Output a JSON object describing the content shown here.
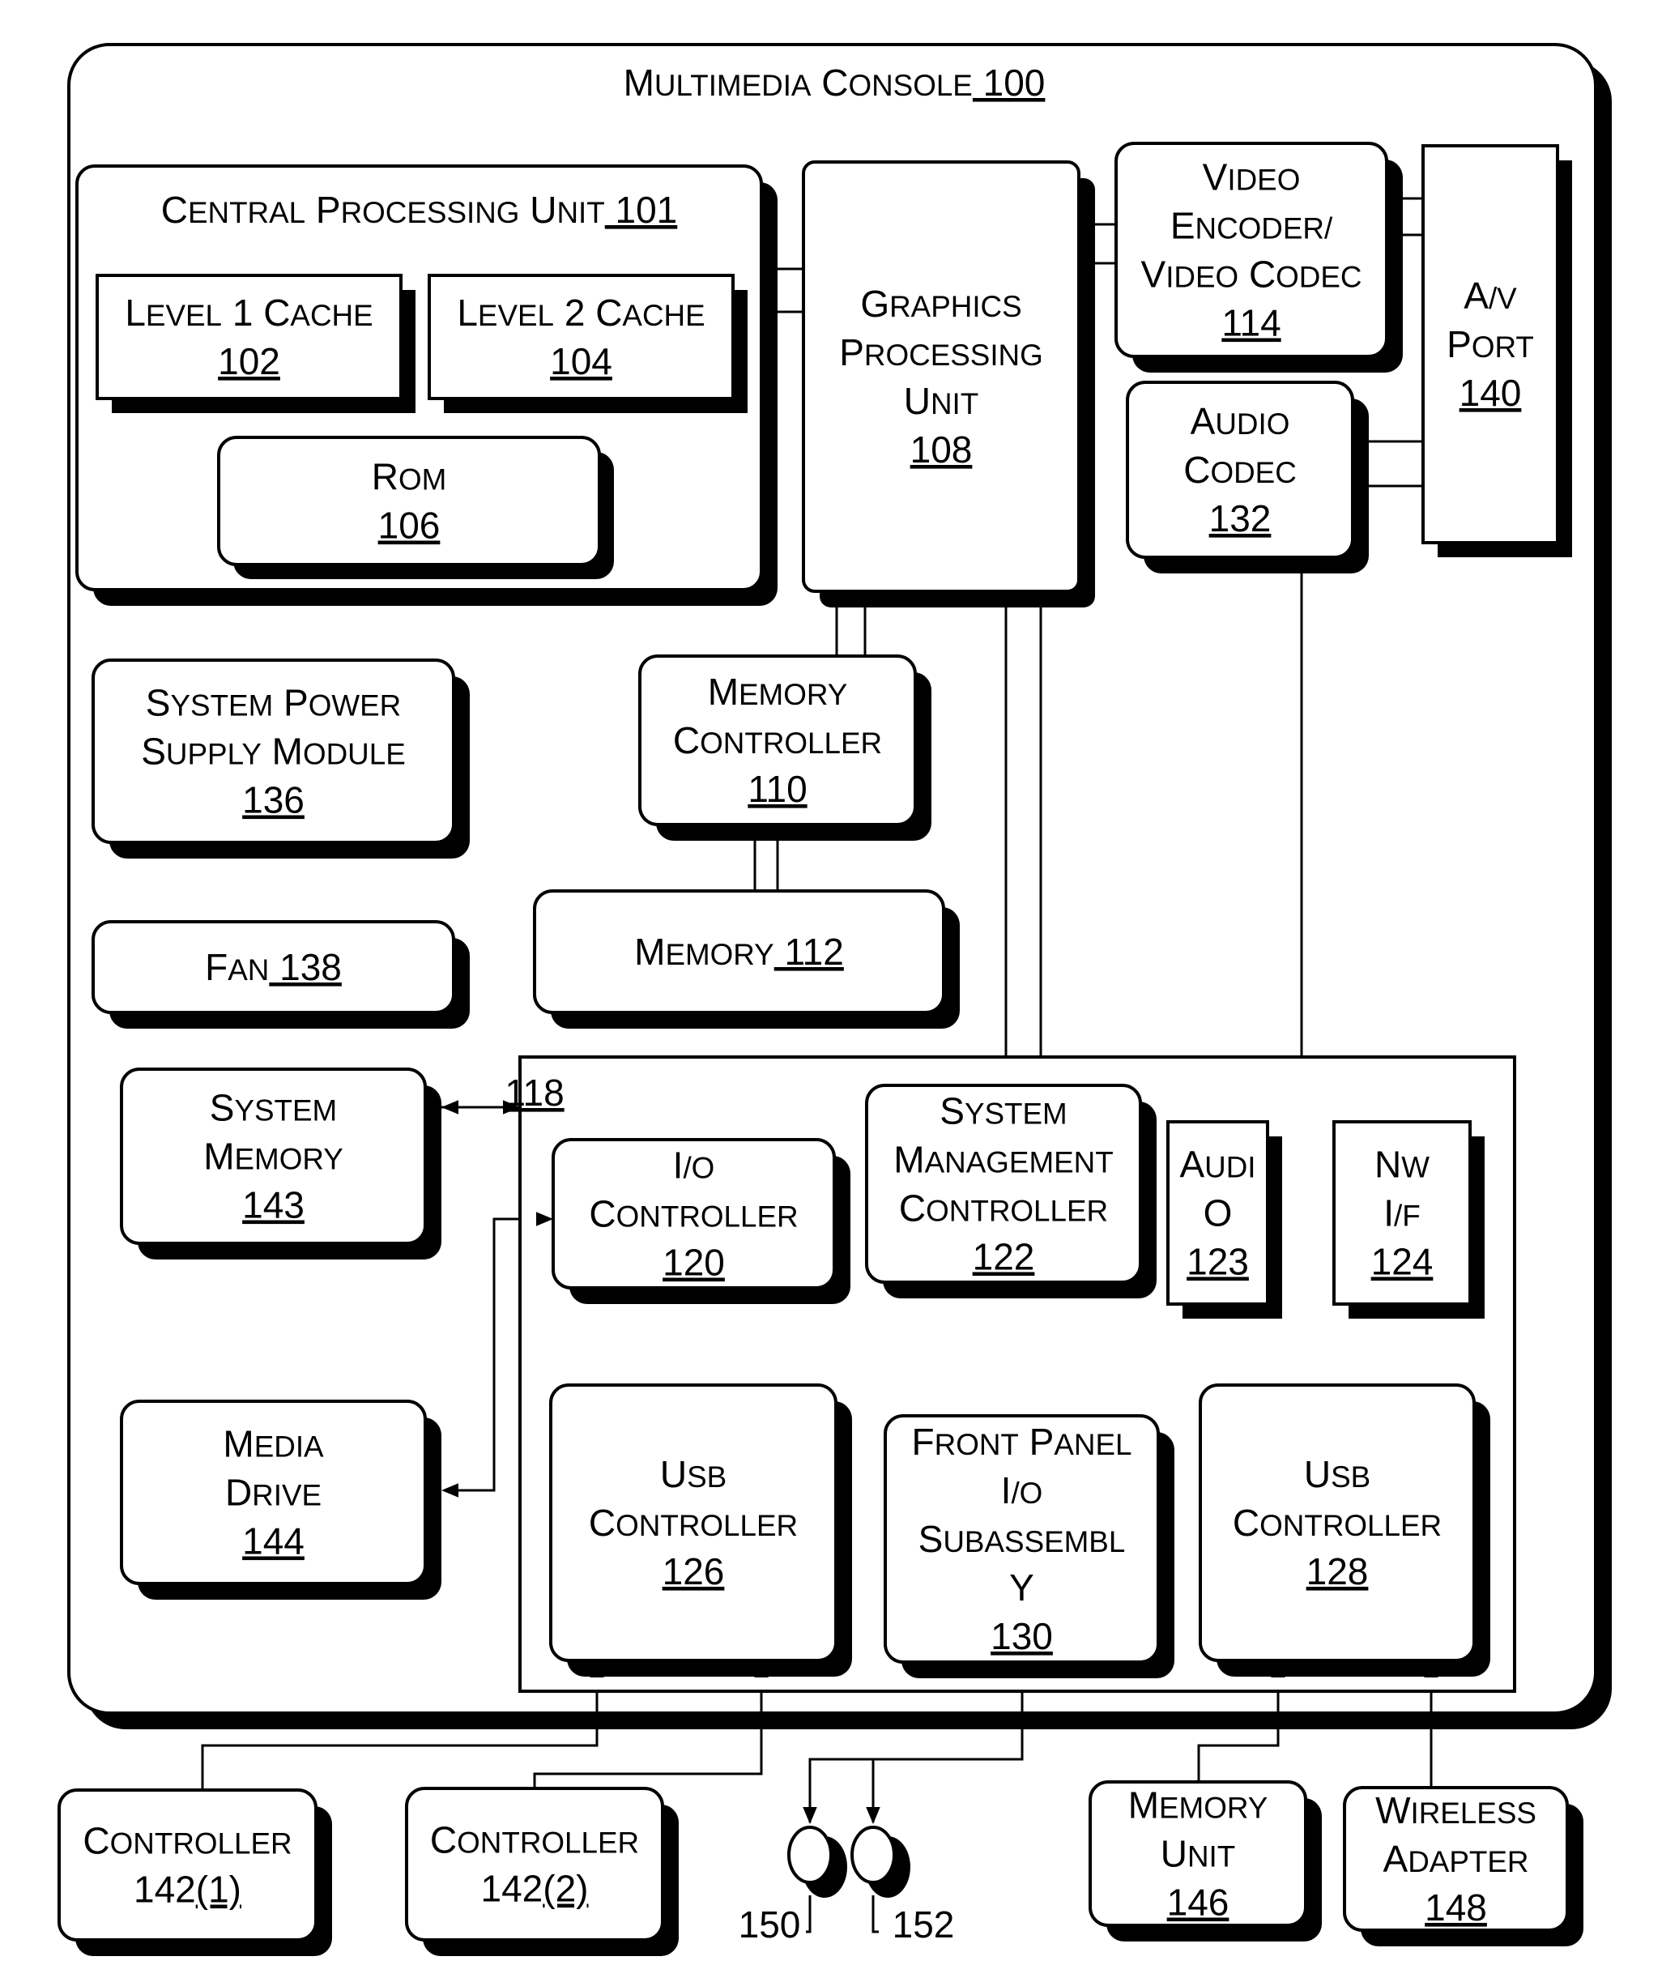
{
  "console": {
    "title": "Multimedia Console",
    "ref": "100"
  },
  "blocks": {
    "cpu": {
      "lines": [
        "Central Processing Unit"
      ],
      "ref": "101"
    },
    "l1": {
      "lines": [
        "Level 1 Cache"
      ],
      "ref": "102"
    },
    "l2": {
      "lines": [
        "Level 2 Cache"
      ],
      "ref": "104"
    },
    "rom": {
      "lines": [
        "ROM"
      ],
      "ref": "106"
    },
    "gpu": {
      "lines": [
        "Graphics",
        "Processing",
        "Unit"
      ],
      "ref": "108"
    },
    "video": {
      "lines": [
        "Video",
        "Encoder/",
        "Video Codec"
      ],
      "ref": "114"
    },
    "av": {
      "lines": [
        "A/V",
        "Port"
      ],
      "ref": "140"
    },
    "audio_codec": {
      "lines": [
        "Audio",
        "Codec"
      ],
      "ref": "132"
    },
    "power": {
      "lines": [
        "System Power",
        "Supply Module"
      ],
      "ref": "136"
    },
    "memctrl": {
      "lines": [
        "Memory",
        "Controller"
      ],
      "ref": "110"
    },
    "memory": {
      "lines": [
        "Memory"
      ],
      "ref": "112"
    },
    "fan": {
      "lines": [
        "Fan"
      ],
      "ref": "138"
    },
    "sysmem": {
      "lines": [
        "System",
        "Memory"
      ],
      "ref": "143"
    },
    "media": {
      "lines": [
        "Media",
        "Drive"
      ],
      "ref": "144"
    },
    "southbridge": {
      "ref": "118"
    },
    "io": {
      "lines": [
        "I/O",
        "controller"
      ],
      "ref": "120"
    },
    "smc": {
      "lines": [
        "System",
        "Management",
        "Controller"
      ],
      "ref": "122"
    },
    "audio123": {
      "lines": [
        "Audi",
        "o"
      ],
      "ref": "123"
    },
    "nw": {
      "lines": [
        "NW",
        "I/F"
      ],
      "ref": "124"
    },
    "usb126": {
      "lines": [
        "USB",
        "Controller"
      ],
      "ref": "126"
    },
    "fp": {
      "lines": [
        "Front Panel",
        "I/O",
        "Subassembl",
        "y"
      ],
      "ref": "130"
    },
    "usb128": {
      "lines": [
        "USB",
        "Controller"
      ],
      "ref": "128"
    },
    "ctrl1": {
      "lines": [
        "Controller"
      ],
      "ref_prefix": "142",
      "ref": "(1)"
    },
    "ctrl2": {
      "lines": [
        "Controller"
      ],
      "ref_prefix": "142",
      "ref": "(2)"
    },
    "memunit": {
      "lines": [
        "Memory",
        "Unit"
      ],
      "ref": "146"
    },
    "wireless": {
      "lines": [
        "Wireless",
        "adapter"
      ],
      "ref": "148"
    }
  },
  "buttons": {
    "power_ref": "150",
    "eject_ref": "152"
  }
}
